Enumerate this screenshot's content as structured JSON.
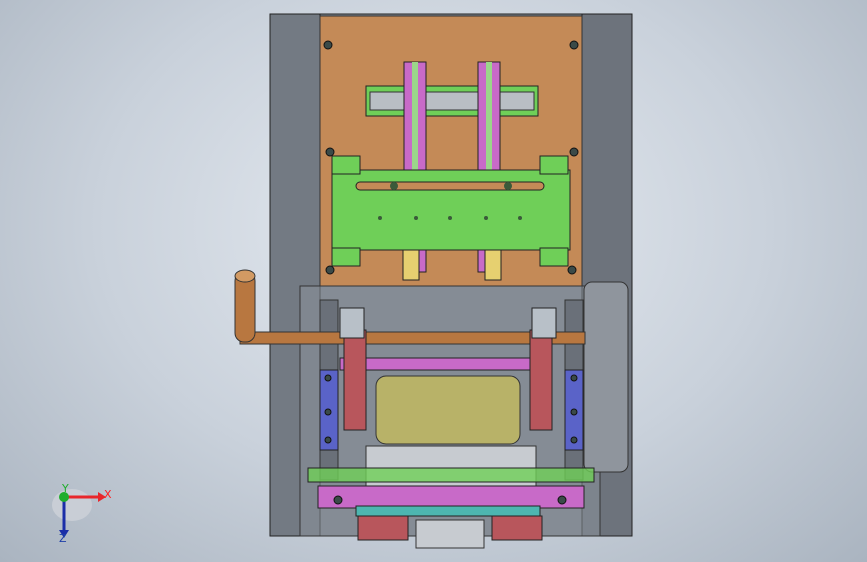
{
  "viewport": {
    "background_top": "#e6ebf1",
    "background_bottom": "#aab4c0"
  },
  "triad": {
    "x_label": "X",
    "y_label": "Y",
    "z_label": "Z",
    "x_color": "#e8262b",
    "y_color": "#1fae2c",
    "z_color": "#1b2ea8"
  },
  "colors": {
    "housing": "#8a9099",
    "back_plate": "#c48a57",
    "green_part": "#6fcf58",
    "magenta_rail": "#c86ac8",
    "blue_part": "#5a63c8",
    "roller": "#b8b268",
    "handle": "#b87740",
    "red_block": "#b8565c"
  }
}
